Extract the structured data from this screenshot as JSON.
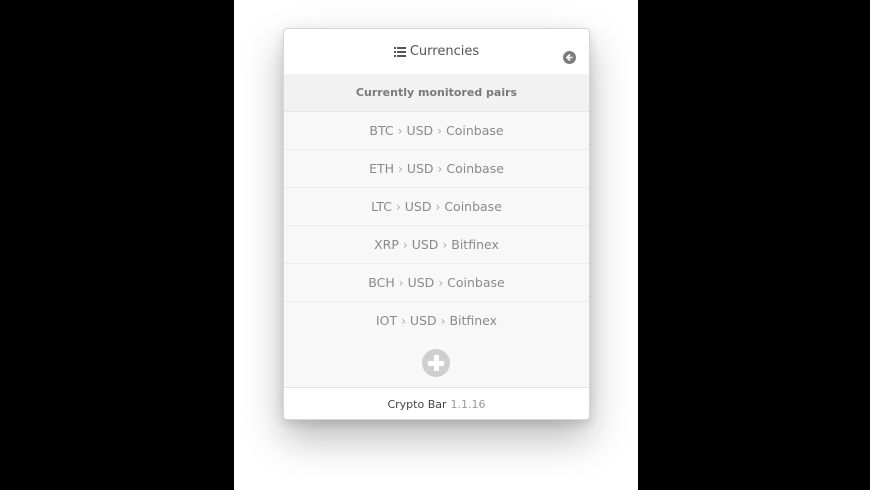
{
  "header": {
    "title": "Currencies",
    "list_icon": "list-icon",
    "back_icon": "back-arrow-icon"
  },
  "subheading": "Currently monitored pairs",
  "pairs": [
    {
      "base": "BTC",
      "quote": "USD",
      "exchange": "Coinbase"
    },
    {
      "base": "ETH",
      "quote": "USD",
      "exchange": "Coinbase"
    },
    {
      "base": "LTC",
      "quote": "USD",
      "exchange": "Coinbase"
    },
    {
      "base": "XRP",
      "quote": "USD",
      "exchange": "Bitfinex"
    },
    {
      "base": "BCH",
      "quote": "USD",
      "exchange": "Coinbase"
    },
    {
      "base": "IOT",
      "quote": "USD",
      "exchange": "Bitfinex"
    }
  ],
  "add_icon": "plus-circle-icon",
  "footer": {
    "app_name": "Crypto Bar",
    "version": "1.1.16"
  },
  "colors": {
    "panel_bg": "#f8f8f8",
    "text": "#8a8a8a",
    "button": "#cfcfcf"
  }
}
